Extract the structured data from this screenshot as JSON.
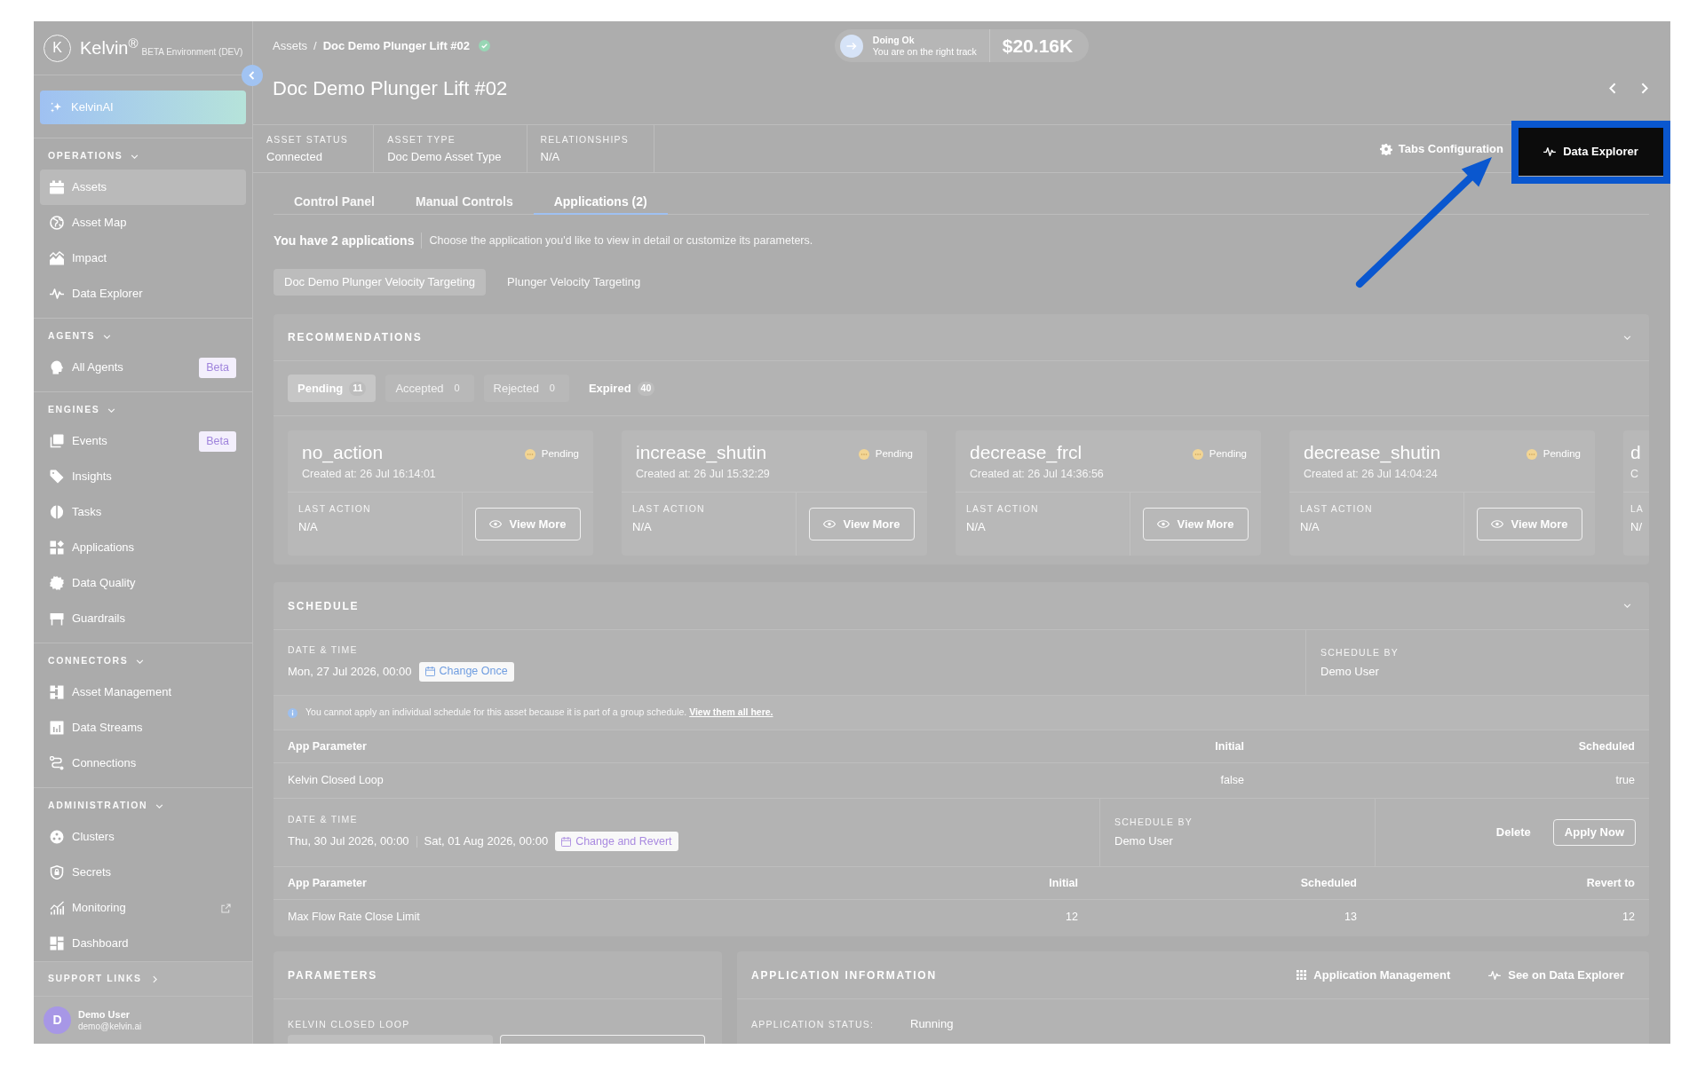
{
  "sidebar": {
    "logo": {
      "mark": "K",
      "name": "Kelvin$^{®}$",
      "environment": "BETA Environment (DEV)"
    },
    "assistant": {
      "label": "KelvinAI"
    },
    "sections": [
      {
        "title": "OPERATIONS",
        "expanded": true,
        "items": [
          {
            "label": "Assets",
            "selected": true,
            "external": false
          },
          {
            "label": "Asset Map",
            "selected": false,
            "external": false
          },
          {
            "label": "Impact",
            "selected": false,
            "external": false
          },
          {
            "label": "Data Explorer",
            "selected": false,
            "external": false
          }
        ]
      },
      {
        "title": "AGENTS",
        "expanded": true,
        "items": [
          {
            "label": "All Agents",
            "selected": false,
            "external": false,
            "badge": "Beta"
          }
        ]
      },
      {
        "title": "ENGINES",
        "expanded": true,
        "items": [
          {
            "label": "Events",
            "selected": false,
            "external": false,
            "badge": "Beta"
          },
          {
            "label": "Insights",
            "selected": false,
            "external": false
          },
          {
            "label": "Tasks",
            "selected": false,
            "external": false
          },
          {
            "label": "Applications",
            "selected": false,
            "external": false
          },
          {
            "label": "Data Quality",
            "selected": false,
            "external": false
          },
          {
            "label": "Guardrails",
            "selected": false,
            "external": false
          }
        ]
      },
      {
        "title": "CONNECTORS",
        "expanded": true,
        "items": [
          {
            "label": "Asset Management",
            "selected": false,
            "external": false
          },
          {
            "label": "Data Streams",
            "selected": false,
            "external": false
          },
          {
            "label": "Connections",
            "selected": false,
            "external": false
          }
        ]
      },
      {
        "title": "ADMINISTRATION",
        "expanded": true,
        "items": [
          {
            "label": "Clusters",
            "selected": false,
            "external": false
          },
          {
            "label": "Secrets",
            "selected": false,
            "external": false
          },
          {
            "label": "Monitoring",
            "selected": false,
            "external": true
          },
          {
            "label": "Dashboard",
            "selected": false,
            "external": false
          }
        ]
      }
    ],
    "support_links": {
      "title": "SUPPORT LINKS",
      "expanded": false
    },
    "user": {
      "initial": "D",
      "name": "Demo User",
      "email": "demo@kelvin.ai"
    }
  },
  "breadcrumb": {
    "items": [
      "Assets",
      "Doc Demo Plunger Lift #02"
    ],
    "separator": "/"
  },
  "status_pill": {
    "title": "Doing Ok",
    "subtitle": "You are on the right track",
    "value": "$20.16K"
  },
  "title": "Doc Demo Plunger Lift #02",
  "asset_info": [
    {
      "label": "ASSET STATUS",
      "value": "Connected"
    },
    {
      "label": "ASSET TYPE",
      "value": "Doc Demo Asset Type"
    },
    {
      "label": "RELATIONSHIPS",
      "value": "N/A"
    }
  ],
  "header_actions": [
    {
      "label": "Tabs Configuration",
      "kind": "link",
      "highlighted": false
    },
    {
      "label": "Data Explorer",
      "kind": "primary",
      "highlighted": true
    }
  ],
  "tabs": [
    {
      "label": "Control Panel",
      "selected": false
    },
    {
      "label": "Manual Controls",
      "selected": false
    },
    {
      "label": "Applications (2)",
      "selected": true
    }
  ],
  "applications": {
    "summary": "You have 2 applications",
    "hint": "Choose the application you'd like to view in detail or customize its parameters.",
    "items": [
      {
        "label": "Doc Demo Plunger Velocity Targeting",
        "selected": true
      },
      {
        "label": "Plunger Velocity Targeting",
        "selected": false
      }
    ]
  },
  "recommendations": {
    "title": "RECOMMENDATIONS",
    "expanded": true,
    "filters": [
      {
        "label": "Pending",
        "count": "11",
        "selected": true,
        "disabled": false
      },
      {
        "label": "Accepted",
        "count": "0",
        "selected": false,
        "disabled": true
      },
      {
        "label": "Rejected",
        "count": "0",
        "selected": false,
        "disabled": true
      },
      {
        "label": "Expired",
        "count": "40",
        "selected": false,
        "disabled": false
      }
    ],
    "cards": [
      {
        "kind": "full",
        "title": "no_action",
        "status": "Pending",
        "created": "Created at: 26 Jul 16:14:01",
        "last_action_label": "LAST ACTION",
        "last_action": "N/A",
        "button": "View More"
      },
      {
        "kind": "full",
        "title": "increase_shutin",
        "status": "Pending",
        "created": "Created at: 26 Jul 15:32:29",
        "last_action_label": "LAST ACTION",
        "last_action": "N/A",
        "button": "View More"
      },
      {
        "kind": "full",
        "title": "decrease_frcl",
        "status": "Pending",
        "created": "Created at: 26 Jul 14:36:56",
        "last_action_label": "LAST ACTION",
        "last_action": "N/A",
        "button": "View More"
      },
      {
        "kind": "full",
        "title": "decrease_shutin",
        "status": "Pending",
        "created": "Created at: 26 Jul 14:04:24",
        "last_action_label": "LAST ACTION",
        "last_action": "N/A",
        "button": "View More"
      },
      {
        "kind": "partial",
        "title": "d",
        "created": "C",
        "last_action_label": "LA",
        "last_action": "N/"
      }
    ]
  },
  "schedule": {
    "title": "SCHEDULE",
    "expanded": true,
    "blocks": [
      {
        "kind": "once",
        "date_label": "DATE & TIME",
        "dates": [
          "Mon, 27 Jul 2026, 00:00"
        ],
        "action": "Change Once",
        "schedule_by_label": "SCHEDULE BY",
        "schedule_by": "Demo User",
        "notice": {
          "text": "You cannot apply an individual schedule for this asset because it is part of a group schedule.",
          "link": "View them all here."
        },
        "table": {
          "columns": [
            "App Parameter",
            "Initial",
            "Scheduled"
          ],
          "rows": [
            [
              "Kelvin Closed Loop",
              "false",
              "true"
            ]
          ]
        }
      },
      {
        "kind": "revert",
        "date_label": "DATE & TIME",
        "dates": [
          "Thu, 30 Jul 2026, 00:00",
          "Sat, 01 Aug 2026, 00:00"
        ],
        "action": "Change and Revert",
        "schedule_by_label": "SCHEDULE BY",
        "schedule_by": "Demo User",
        "buttons": [
          {
            "label": "Delete",
            "kind": "text"
          },
          {
            "label": "Apply Now",
            "kind": "outline"
          }
        ],
        "table": {
          "columns": [
            "App Parameter",
            "Initial",
            "Scheduled",
            "Revert to"
          ],
          "rows": [
            [
              "Max Flow Rate Close Limit",
              "12",
              "13",
              "12"
            ]
          ]
        }
      }
    ]
  },
  "parameters": {
    "title": "PARAMETERS",
    "field_label": "KELVIN CLOSED LOOP"
  },
  "application_information": {
    "title": "APPLICATION INFORMATION",
    "actions": [
      "Application Management",
      "See on Data Explorer"
    ],
    "fields": [
      {
        "label": "APPLICATION STATUS:",
        "value": "Running"
      }
    ]
  }
}
